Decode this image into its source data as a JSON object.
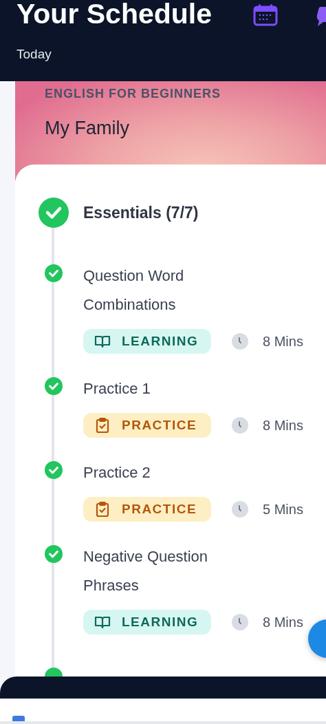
{
  "header": {
    "title": "Your Schedule",
    "subtitle": "Today"
  },
  "course": {
    "category": "ENGLISH FOR BEGINNERS",
    "title": "My Family"
  },
  "section": {
    "title": "Essentials (7/7)",
    "completed": true
  },
  "lessons": [
    {
      "title": "Question Word Combinations",
      "kind": "learning",
      "tag": "LEARNING",
      "duration": "8 Mins",
      "completed": true
    },
    {
      "title": "Practice 1",
      "kind": "practice",
      "tag": "PRACTICE",
      "duration": "8 Mins",
      "completed": true
    },
    {
      "title": "Practice 2",
      "kind": "practice",
      "tag": "PRACTICE",
      "duration": "5 Mins",
      "completed": true
    },
    {
      "title": "Negative Question Phrases",
      "kind": "learning",
      "tag": "LEARNING",
      "duration": "8 Mins",
      "completed": true
    }
  ]
}
